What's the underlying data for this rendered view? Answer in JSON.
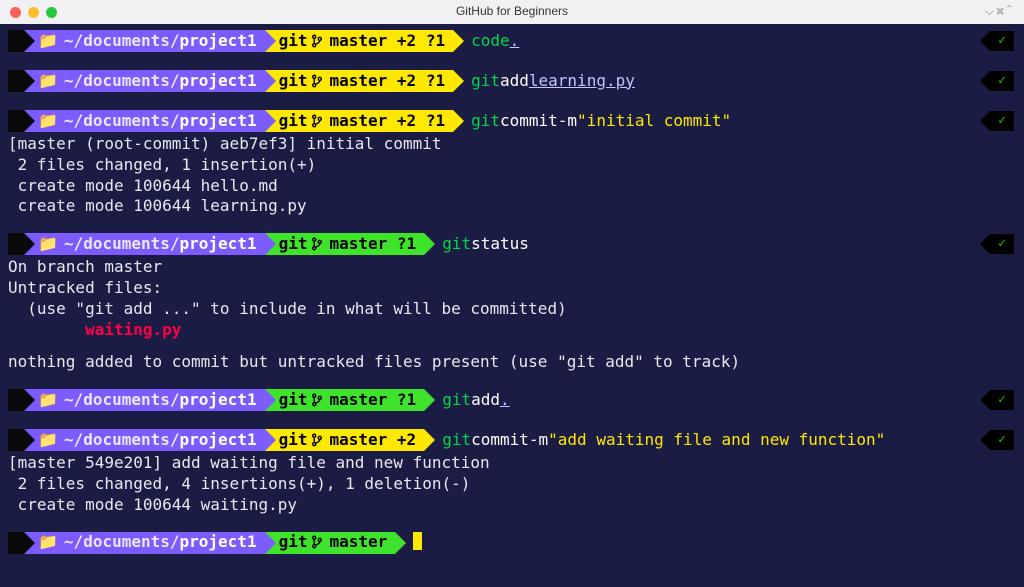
{
  "window": {
    "title": "GitHub for Beginners",
    "controls_glyph": "⌵⌘⌃"
  },
  "icons": {
    "apple": "",
    "folder": "📁",
    "check": "✓"
  },
  "path": {
    "prefix": "~/documents/",
    "project": "project1"
  },
  "branch": {
    "git_label": "git",
    "name": "master",
    "status_plus2_q1": " +2 ?1",
    "status_q1": " ?1",
    "status_plus2": " +2",
    "status_none": ""
  },
  "blocks": [
    {
      "branch_bg": "yellow",
      "status_key": "status_plus2_q1",
      "cmd": {
        "program": "code",
        "arg": ".",
        "string": ""
      },
      "output": []
    },
    {
      "branch_bg": "yellow",
      "status_key": "status_plus2_q1",
      "cmd": {
        "program": "git",
        "sub": "add",
        "arg": "learning.py",
        "string": ""
      },
      "output": []
    },
    {
      "branch_bg": "yellow",
      "status_key": "status_plus2_q1",
      "cmd": {
        "program": "git",
        "sub": "commit",
        "flag": "-m",
        "string": "\"initial commit\""
      },
      "output": [
        "[master (root-commit) aeb7ef3] initial commit",
        " 2 files changed, 1 insertion(+)",
        " create mode 100644 hello.md",
        " create mode 100644 learning.py"
      ]
    },
    {
      "branch_bg": "green",
      "status_key": "status_q1",
      "cmd": {
        "program": "git",
        "sub": "status"
      },
      "output": [
        "On branch master",
        "Untracked files:",
        "  (use \"git add <file>...\" to include in what will be committed)",
        {
          "indent": "        ",
          "red": "waiting.py"
        },
        "",
        "nothing added to commit but untracked files present (use \"git add\" to track)"
      ]
    },
    {
      "branch_bg": "green",
      "status_key": "status_q1",
      "cmd": {
        "program": "git",
        "sub": "add",
        "arg": "."
      },
      "output": []
    },
    {
      "branch_bg": "yellow",
      "status_key": "status_plus2",
      "cmd": {
        "program": "git",
        "sub": "commit",
        "flag": "-m",
        "string": "\"add waiting file and new function\""
      },
      "output": [
        "[master 549e201] add waiting file and new function",
        " 2 files changed, 4 insertions(+), 1 deletion(-)",
        " create mode 100644 waiting.py"
      ]
    },
    {
      "branch_bg": "green",
      "status_key": "status_none",
      "cmd": null,
      "cursor": true,
      "output": []
    }
  ]
}
